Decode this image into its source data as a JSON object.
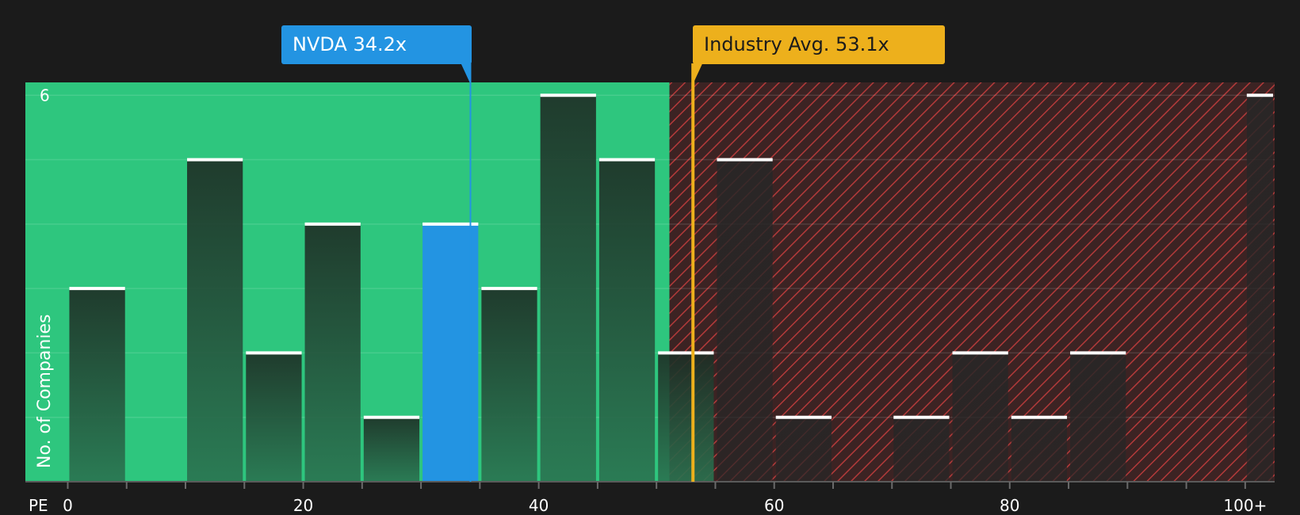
{
  "chart_data": {
    "type": "bar",
    "title": "",
    "xlabel": "PE",
    "ylabel": "No. of Companies",
    "x_tick_labels": [
      "0",
      "20",
      "40",
      "60",
      "80",
      "100+"
    ],
    "x_ticks": [
      0,
      20,
      40,
      60,
      80,
      100
    ],
    "x_range": [
      -3.6,
      102.5
    ],
    "ylim": [
      0,
      6.2
    ],
    "y_tick_labels": [
      "6"
    ],
    "grid": true,
    "bins": [
      {
        "start": 0,
        "end": 5,
        "count": 3
      },
      {
        "start": 10,
        "end": 15,
        "count": 5
      },
      {
        "start": 15,
        "end": 20,
        "count": 2
      },
      {
        "start": 20,
        "end": 25,
        "count": 4
      },
      {
        "start": 25,
        "end": 30,
        "count": 1
      },
      {
        "start": 30,
        "end": 35,
        "count": 4,
        "highlight": true
      },
      {
        "start": 35,
        "end": 40,
        "count": 3
      },
      {
        "start": 40,
        "end": 45,
        "count": 6
      },
      {
        "start": 45,
        "end": 50,
        "count": 5
      },
      {
        "start": 50,
        "end": 55,
        "count": 2
      },
      {
        "start": 55,
        "end": 60,
        "count": 5
      },
      {
        "start": 60,
        "end": 65,
        "count": 1
      },
      {
        "start": 70,
        "end": 75,
        "count": 1
      },
      {
        "start": 75,
        "end": 80,
        "count": 2
      },
      {
        "start": 80,
        "end": 85,
        "count": 1
      },
      {
        "start": 85,
        "end": 90,
        "count": 2
      },
      {
        "start": 100,
        "end": 102.5,
        "count": 6
      }
    ],
    "fair_range_end": 51.1,
    "markers": {
      "company": {
        "label": "NVDA 34.2x",
        "value": 34.2,
        "color": "#2394e2"
      },
      "industry": {
        "label": "Industry Avg. 53.1x",
        "value": 53.1,
        "color": "#edb01c"
      }
    },
    "colors": {
      "background": "#1b1b1b",
      "fair_zone": "#2ec67e",
      "over_zone": "#b33a3a",
      "bar": "#1e2c24",
      "bar_light": "#2a7350",
      "bar_highlight": "#2394e2",
      "bar_cap": "#ffffff"
    }
  }
}
